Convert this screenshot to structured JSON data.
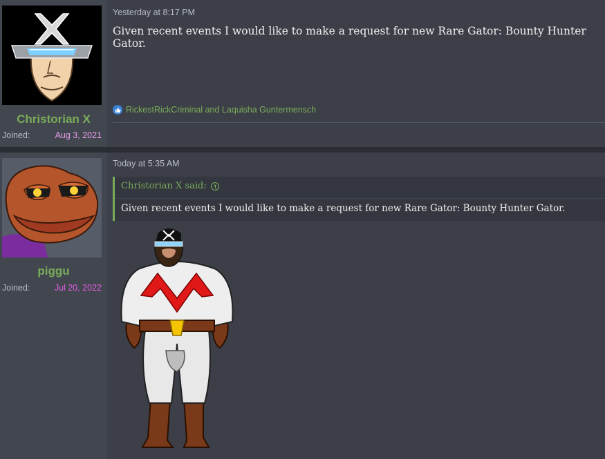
{
  "posts": [
    {
      "username": "Christorian X",
      "joined_label": "Joined:",
      "joined_date": "Aug 3, 2021",
      "joined_color": "#e79de6",
      "timestamp": "Yesterday at 8:17 PM",
      "body": "Given recent events I would like to make a request for new Rare Gator: Bounty Hunter Gator.",
      "reactions": {
        "icon": "thumbs-up-icon",
        "text": "RickestRickCriminal and Laquisha Guntermensch"
      }
    },
    {
      "username": "piggu",
      "joined_label": "Joined:",
      "joined_date": "Jul 20, 2022",
      "joined_color": "#e05ee0",
      "timestamp": "Today at 5:35 AM",
      "quote": {
        "author_said": "Christorian X said:",
        "icon": "arrow-up-circle-icon",
        "text": "Given recent events I would like to make a request for new Rare Gator: Bounty Hunter Gator."
      },
      "image": "superhero-cartoon-image"
    }
  ],
  "colors": {
    "username": "#7aad5a",
    "link": "#7aad5a",
    "text": "#f0f0f0",
    "muted": "#b9bcc3"
  }
}
